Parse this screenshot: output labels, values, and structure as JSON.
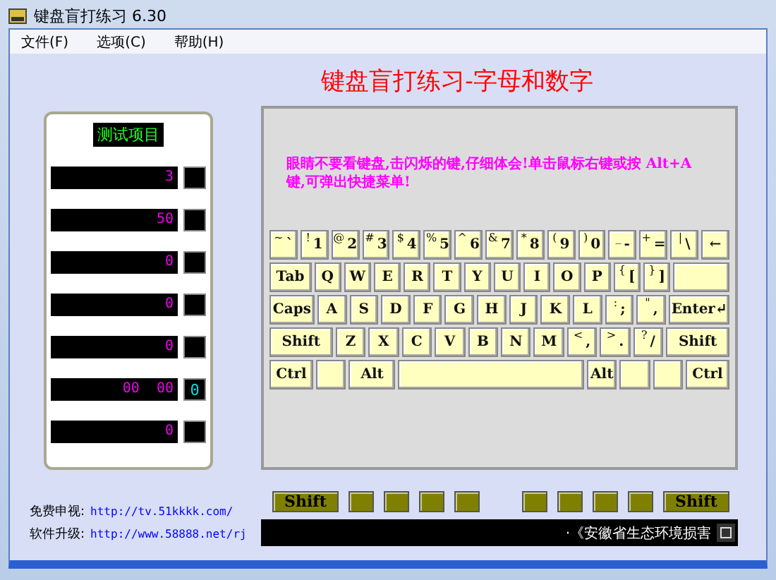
{
  "window": {
    "title": "键盘盲打练习 6.30"
  },
  "menu": [
    "文件(F)",
    "选项(C)",
    "帮助(H)"
  ],
  "heading": "键盘盲打练习-字母和数字",
  "stats": {
    "title": "测试项目",
    "rows": [
      {
        "value": "3"
      },
      {
        "value": "50"
      },
      {
        "value": "0"
      },
      {
        "value": "0"
      },
      {
        "value": "0"
      },
      {
        "value": "00  00",
        "extra": "0"
      },
      {
        "value": "0"
      }
    ]
  },
  "hint": "眼睛不要看键盘,击闪烁的键,仔细体会!单击鼠标右键或按 Alt+A 键,可弹出快捷菜单!",
  "keyboard": [
    [
      {
        "kind": "char",
        "shift": "~",
        "label": "`"
      },
      {
        "kind": "char",
        "shift": "!",
        "label": "1"
      },
      {
        "kind": "char",
        "shift": "@",
        "label": "2"
      },
      {
        "kind": "char",
        "shift": "#",
        "label": "3"
      },
      {
        "kind": "char",
        "shift": "$",
        "label": "4"
      },
      {
        "kind": "char",
        "shift": "%",
        "label": "5"
      },
      {
        "kind": "char",
        "shift": "^",
        "label": "6"
      },
      {
        "kind": "char",
        "shift": "&",
        "label": "7"
      },
      {
        "kind": "char",
        "shift": "*",
        "label": "8"
      },
      {
        "kind": "char",
        "shift": "(",
        "label": "9"
      },
      {
        "kind": "char",
        "shift": ")",
        "label": "0"
      },
      {
        "kind": "char",
        "shift": "_",
        "label": "-"
      },
      {
        "kind": "char",
        "shift": "+",
        "label": "="
      },
      {
        "kind": "char",
        "shift": "|",
        "label": "\\"
      },
      {
        "kind": "char",
        "label": "←"
      }
    ],
    [
      {
        "kind": "wide",
        "label": "Tab"
      },
      {
        "kind": "char",
        "label": "Q"
      },
      {
        "kind": "char",
        "label": "W"
      },
      {
        "kind": "char",
        "label": "E"
      },
      {
        "kind": "char",
        "label": "R"
      },
      {
        "kind": "char",
        "label": "T"
      },
      {
        "kind": "char",
        "label": "Y"
      },
      {
        "kind": "char",
        "label": "U"
      },
      {
        "kind": "char",
        "label": "I"
      },
      {
        "kind": "char",
        "label": "O"
      },
      {
        "kind": "char",
        "label": "P"
      },
      {
        "kind": "char",
        "shift": "{",
        "label": "["
      },
      {
        "kind": "char",
        "shift": "}",
        "label": "]"
      },
      {
        "kind": "enter"
      }
    ],
    [
      {
        "kind": "wide",
        "label": "Caps"
      },
      {
        "kind": "char",
        "label": "A"
      },
      {
        "kind": "char",
        "label": "S"
      },
      {
        "kind": "char",
        "label": "D"
      },
      {
        "kind": "char",
        "label": "F"
      },
      {
        "kind": "char",
        "label": "G"
      },
      {
        "kind": "char",
        "label": "H"
      },
      {
        "kind": "char",
        "label": "J"
      },
      {
        "kind": "char",
        "label": "K"
      },
      {
        "kind": "char",
        "label": "L"
      },
      {
        "kind": "char",
        "shift": ":",
        "label": ";"
      },
      {
        "kind": "char",
        "shift": "\"",
        "label": ","
      },
      {
        "kind": "enter",
        "label": "Enter↵"
      }
    ],
    [
      {
        "kind": "shift",
        "label": "Shift"
      },
      {
        "kind": "char",
        "label": "Z"
      },
      {
        "kind": "char",
        "label": "X"
      },
      {
        "kind": "char",
        "label": "C"
      },
      {
        "kind": "char",
        "label": "V"
      },
      {
        "kind": "char",
        "label": "B"
      },
      {
        "kind": "char",
        "label": "N"
      },
      {
        "kind": "char",
        "label": "M"
      },
      {
        "kind": "char",
        "shift": "<",
        "label": ","
      },
      {
        "kind": "char",
        "shift": ">",
        "label": "."
      },
      {
        "kind": "char",
        "shift": "?",
        "label": "/"
      },
      {
        "kind": "shift",
        "label": "Shift"
      }
    ],
    [
      {
        "kind": "ctrl",
        "label": "Ctrl"
      },
      {
        "kind": "char"
      },
      {
        "kind": "wide",
        "label": "Alt"
      },
      {
        "kind": "space"
      },
      {
        "kind": "char",
        "label": "Alt"
      },
      {
        "kind": "char"
      },
      {
        "kind": "char"
      },
      {
        "kind": "ctrl",
        "label": "Ctrl"
      }
    ]
  ],
  "indicators": [
    {
      "kind": "shift",
      "label": "Shift"
    },
    {
      "kind": "blank"
    },
    {
      "kind": "blank"
    },
    {
      "kind": "blank"
    },
    {
      "kind": "blank"
    },
    {
      "kind": "gap"
    },
    {
      "kind": "blank"
    },
    {
      "kind": "blank"
    },
    {
      "kind": "blank"
    },
    {
      "kind": "blank"
    },
    {
      "kind": "shift",
      "label": "Shift"
    }
  ],
  "links": [
    {
      "label": "免费申视:",
      "url": "http://tv.51kkkk.com/"
    },
    {
      "label": "软件升级:",
      "url": "http://www.58888.net/rj"
    }
  ],
  "ticker": "·《安徽省生态环境损害"
}
